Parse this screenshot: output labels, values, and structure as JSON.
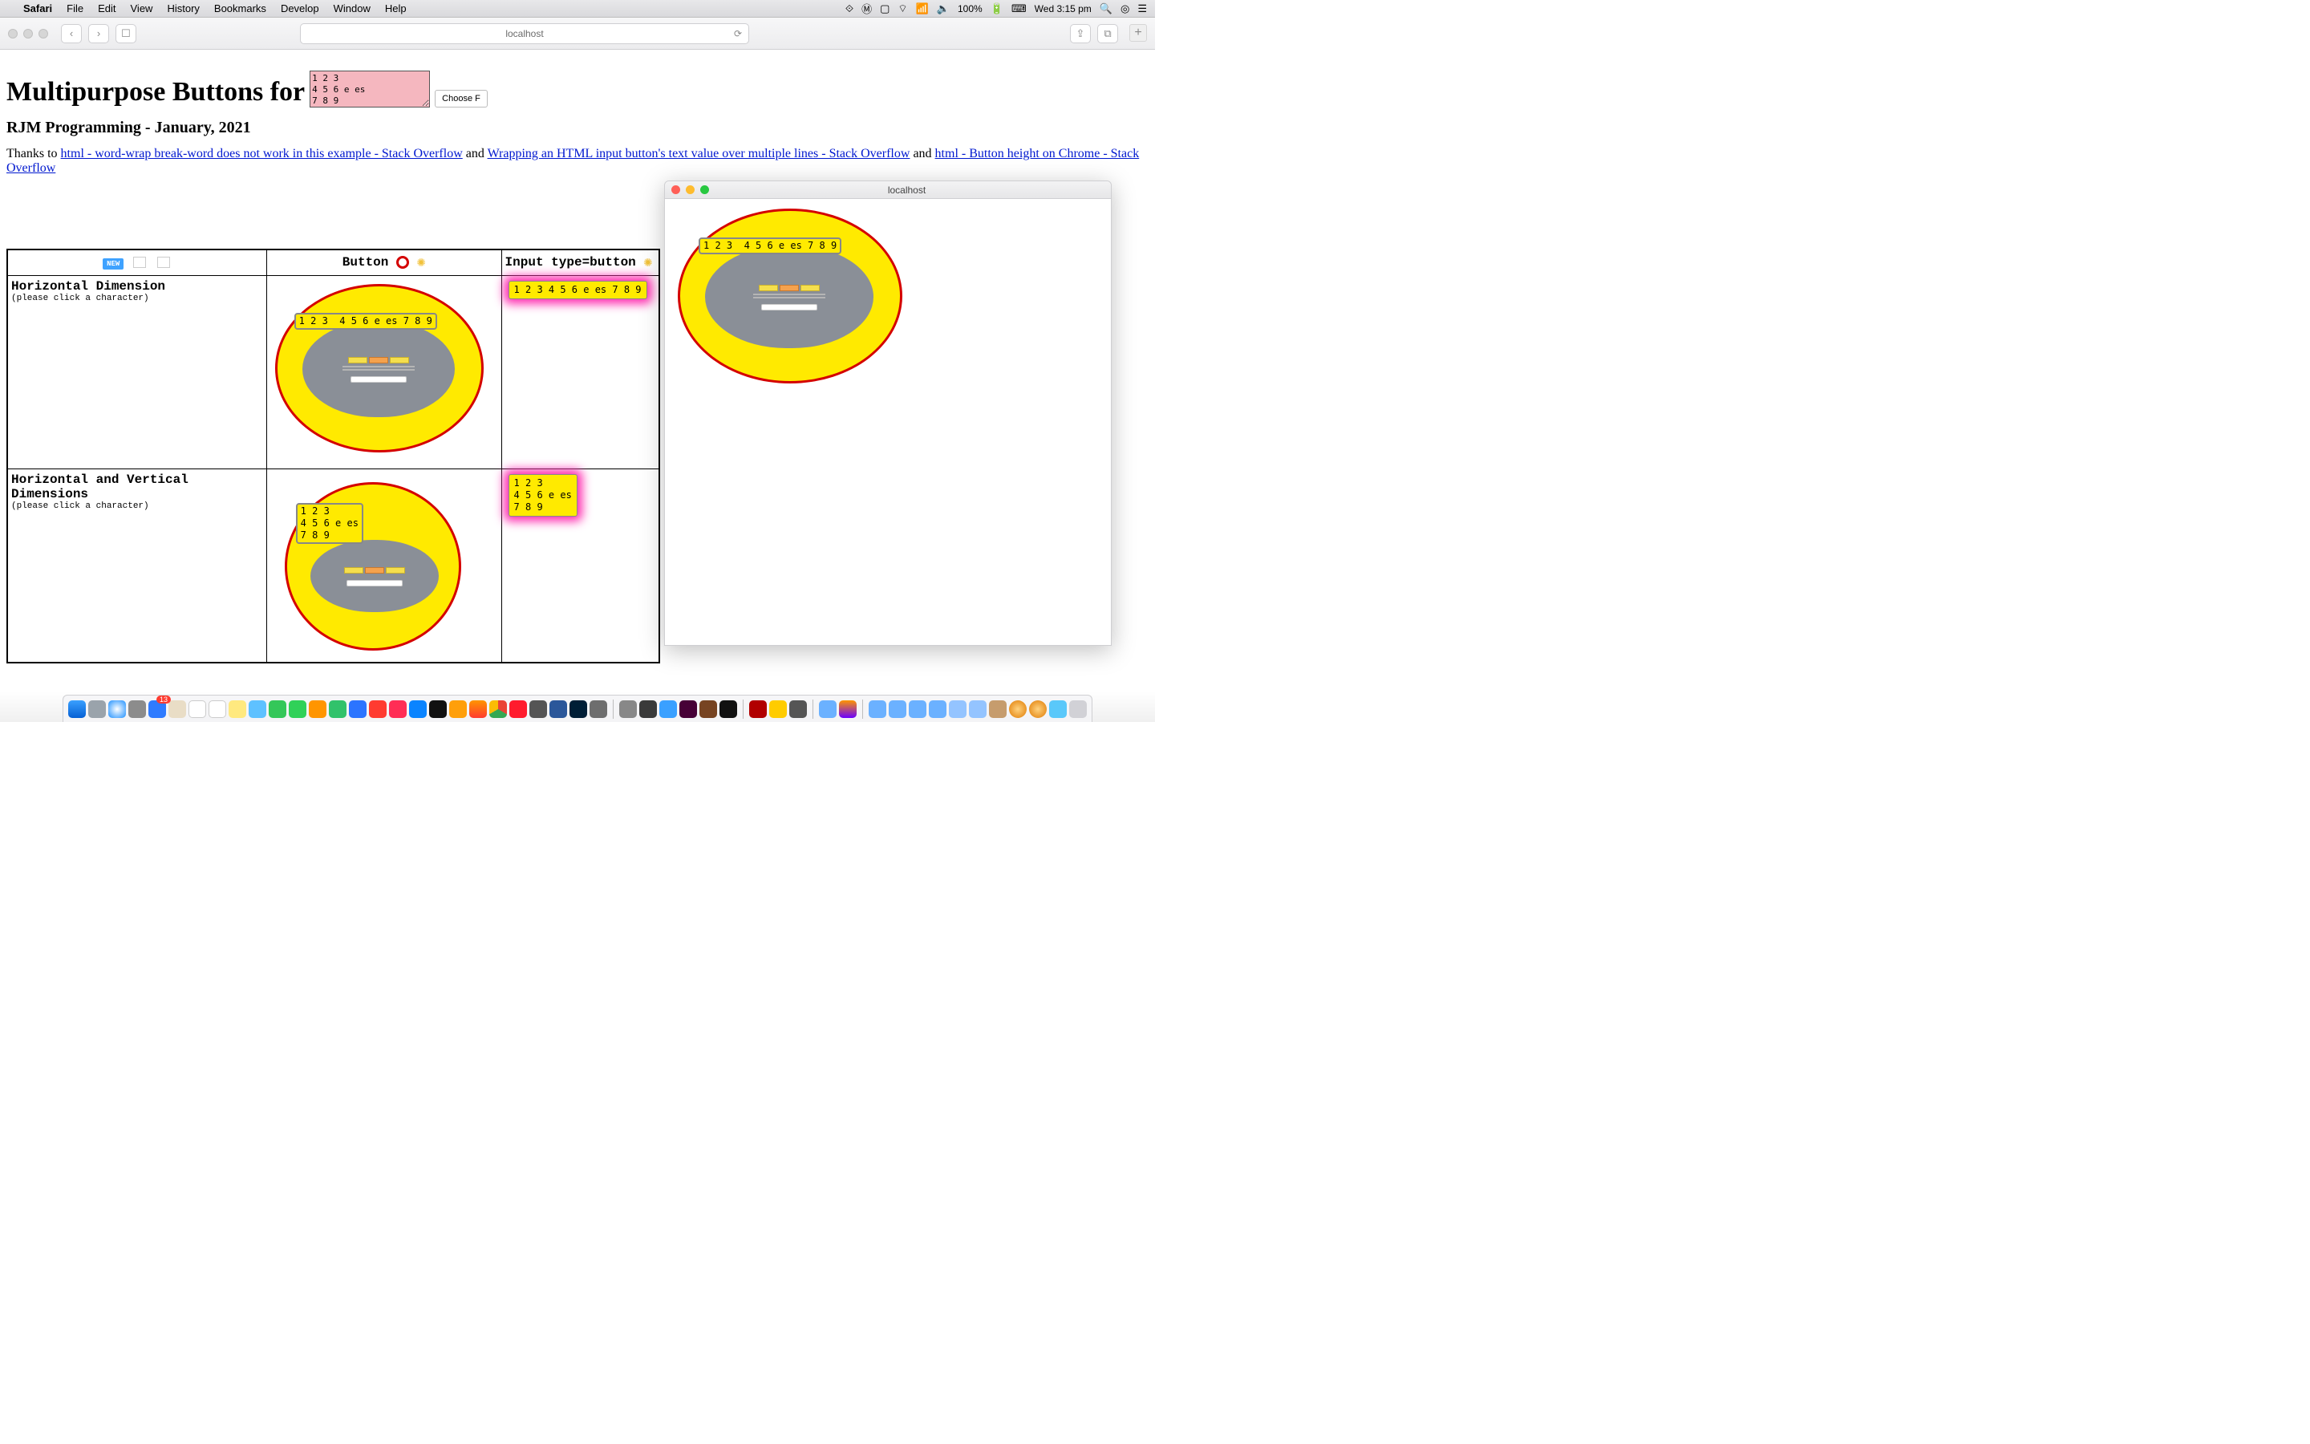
{
  "menubar": {
    "items": [
      "Safari",
      "File",
      "Edit",
      "View",
      "History",
      "Bookmarks",
      "Develop",
      "Window",
      "Help"
    ],
    "battery": "100%",
    "clock": "Wed 3:15 pm"
  },
  "safari": {
    "url": "localhost"
  },
  "page": {
    "h1_prefix": "Multipurpose Buttons for",
    "pink_textarea": "1 2 3\n4 5 6 e es\n7 8 9",
    "choose_label": "Choose F",
    "h3": "RJM Programming - January, 2021",
    "thanks_prefix": "Thanks to ",
    "link1": "html - word-wrap break-word does not work in this example - Stack Overflow",
    "mid1": " and ",
    "link2": "Wrapping an HTML input button's text value over multiple lines - Stack Overflow",
    "mid2": " and ",
    "link3": "html - Button height on Chrome - Stack Overflow"
  },
  "table": {
    "head": {
      "new": "NEW",
      "col2": "Button",
      "col3": "Input type=button"
    },
    "row1": {
      "title": "Horizontal Dimension",
      "sub": "(please click a character)",
      "btn2": "1 2 3  4 5 6 e es 7 8 9",
      "btn3": "1 2 3 4 5 6 e es 7 8 9"
    },
    "row2": {
      "title": "Horizontal and Vertical Dimensions",
      "sub": "(please click a character)",
      "btn2": "1 2 3\n4 5 6 e es\n7 8 9",
      "btn3": "1 2 3\n4 5 6 e es\n7 8 9"
    }
  },
  "popup": {
    "title": "localhost",
    "btn": "1 2 3  4 5 6 e es 7 8 9"
  },
  "dock": {
    "badge": "13"
  }
}
